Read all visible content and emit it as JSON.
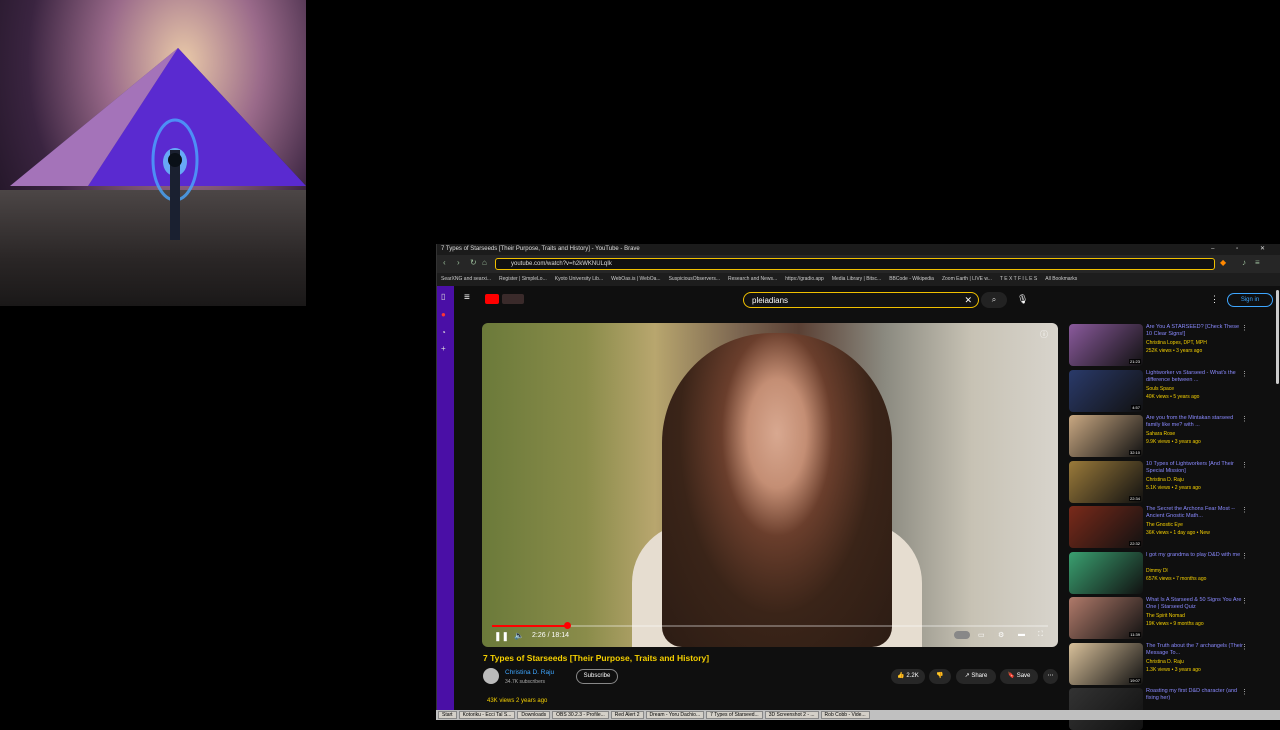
{
  "window": {
    "title": "7 Types of Starseeds [Their Purpose, Traits and History] - YouTube - Brave",
    "controls": "– ▫ ✕"
  },
  "address": {
    "url": "youtube.com/watch?v=h2kWKNULqIk"
  },
  "bookmarks": [
    "SearXNG and searxi...",
    "Register | SimpleLo...",
    "Kyoto University Lib...",
    "WebOas.is | WebOa...",
    "SuspiciousObservers...",
    "Research and News...",
    "https://gradio.app",
    "Media Library | Bitsc...",
    "BBCode - Wikipedia",
    "Zoom Earth | LIVE w...",
    "T E X T F I L E S",
    "All Bookmarks"
  ],
  "search": {
    "value": "pleiadians"
  },
  "header": {
    "signin": "Sign in"
  },
  "video": {
    "time": "2:26 / 18:14",
    "progress": 0.134,
    "title": "7 Types of Starseeds [Their Purpose, Traits and History]",
    "channel": "Christina D. Raju",
    "subscribers": "34.7K subscribers",
    "subscribe": "Subscribe",
    "likes": "2.2K",
    "share": "Share",
    "save": "Save",
    "views": "43K views  2 years ago"
  },
  "recommendations": [
    {
      "title": "Are You A STARSEED? [Check These 10 Clear Signs!]",
      "channel": "Christina Lopes, DPT, MPH",
      "meta": "252K views • 3 years ago",
      "duration": "21:23",
      "color": "#8a5a9c"
    },
    {
      "title": "Lightworker vs Starseed - What's the difference between ...",
      "channel": "Souls Space",
      "meta": "40K views • 5 years ago",
      "duration": "4:57",
      "color": "#2a3a6a"
    },
    {
      "title": "Are you from the Mintakan starseed family like me? with ...",
      "channel": "Sahara Rose",
      "meta": "9.9K views • 3 years ago",
      "duration": "32:10",
      "color": "#c9a882"
    },
    {
      "title": "10 Types of Lightworkers [And Their Special Mission]",
      "channel": "Christina D. Raju",
      "meta": "5.1K views • 2 years ago",
      "duration": "22:34",
      "color": "#9a7a3a"
    },
    {
      "title": "The Secret the Archons Fear Most -- Ancient Gnostic Math...",
      "channel": "The Gnostic Eye",
      "meta": "36K views • 1 day ago • New",
      "duration": "22:32",
      "color": "#7a2a1a"
    },
    {
      "title": "I got my grandma to play D&D with me",
      "channel": "Dimmy Dl",
      "meta": "657K views • 7 months ago",
      "duration": "",
      "color": "#3aa070"
    },
    {
      "title": "What Is A Starseed & 50 Signs You Are One | Starseed Quiz",
      "channel": "The Spirit Nomad",
      "meta": "19K views • 9 months ago",
      "duration": "11:39",
      "color": "#b07a6a"
    },
    {
      "title": "The Truth about the 7 archangels (Their Message To...",
      "channel": "Christina D. Raju",
      "meta": "1.3K views • 3 years ago",
      "duration": "19:07",
      "color": "#d8c09a"
    },
    {
      "title": "Roasting my first D&D character (and fixing her)",
      "channel": "",
      "meta": "",
      "duration": "",
      "color": "#333"
    }
  ],
  "taskbar": [
    "Start",
    "Kotoriku - Ecci Tal S...",
    "Downloads",
    "OBS 30.2.3 - Profile...",
    "Red Alert 2",
    "Dream - Yoru Dachio...",
    "7 Types of Starseed...",
    "3D Screenshot 2 - ...",
    "Rob Cobb - Vide..."
  ]
}
